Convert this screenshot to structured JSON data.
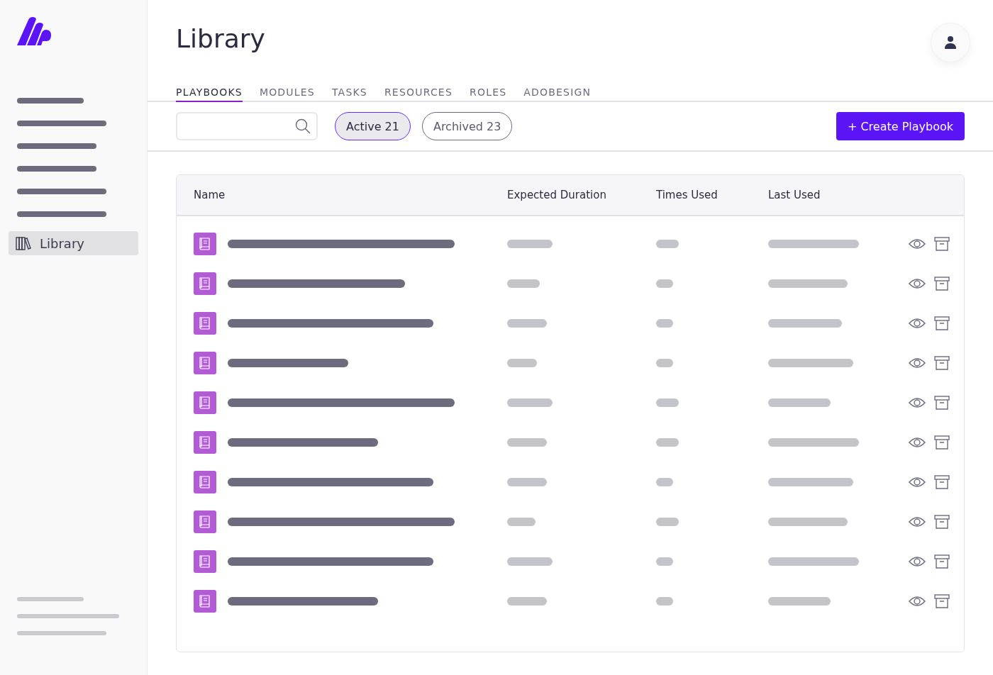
{
  "sidebar": {
    "items": [
      {
        "label": "Library",
        "selected": true
      }
    ]
  },
  "page": {
    "title": "Library"
  },
  "tabs": [
    {
      "label": "PLAYBOOKS",
      "selected": true
    },
    {
      "label": "MODULES",
      "selected": false
    },
    {
      "label": "TASKS",
      "selected": false
    },
    {
      "label": "RESOURCES",
      "selected": false
    },
    {
      "label": "ROLES",
      "selected": false
    },
    {
      "label": "ADOBESIGN",
      "selected": false
    }
  ],
  "filters": [
    {
      "label": "Active 21",
      "selected": true
    },
    {
      "label": "Archived 23",
      "selected": false
    }
  ],
  "create_button": "+ Create Playbook",
  "table": {
    "columns": [
      "Name",
      "Expected Duration",
      "Times Used",
      "Last Used"
    ]
  }
}
